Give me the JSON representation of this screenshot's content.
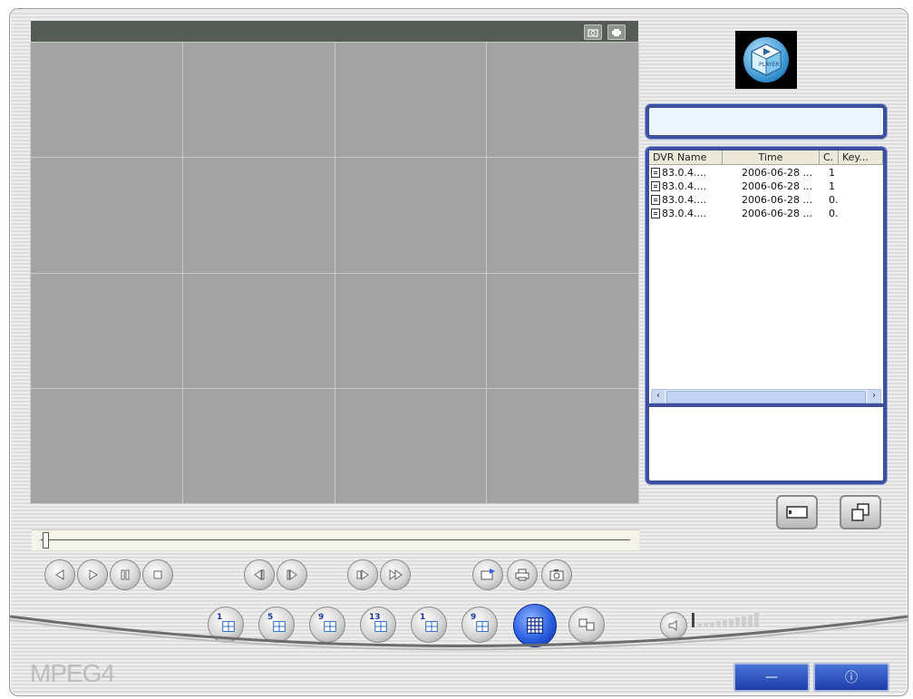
{
  "app": {
    "brand_label": "MPEG4",
    "logo_text": "PLAYER"
  },
  "titlebar": {
    "icons": [
      "camera-icon",
      "printer-icon"
    ]
  },
  "video": {
    "channel_count": 16
  },
  "file_list": {
    "columns": [
      "DVR Name",
      "Time",
      "C.",
      "Key..."
    ],
    "rows": [
      {
        "name": "83.0.4....",
        "time": "2006-06-28 ...",
        "c": "1"
      },
      {
        "name": "83.0.4....",
        "time": "2006-06-28 ...",
        "c": "1"
      },
      {
        "name": "83.0.4....",
        "time": "2006-06-28 ...",
        "c": "0."
      },
      {
        "name": "83.0.4....",
        "time": "2006-06-28 ...",
        "c": "0."
      }
    ]
  },
  "layout_buttons": [
    "1",
    "5",
    "9",
    "13",
    "1",
    "9"
  ],
  "window_controls": {
    "minimize": "—",
    "power": "ⓘ"
  },
  "colors": {
    "accent": "#3d4f9e",
    "video_bg": "#a3a3a3",
    "active": "#2a5fe0"
  }
}
